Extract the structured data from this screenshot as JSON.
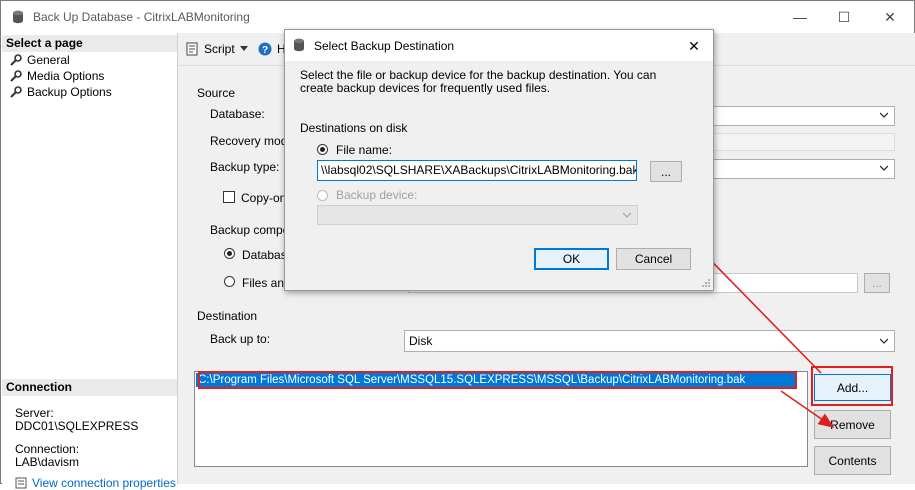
{
  "window": {
    "title": "Back Up Database - CitrixLABMonitoring",
    "minimize": "—",
    "maximize": "☐",
    "close": "✕"
  },
  "left_pane": {
    "select_header": "Select a page",
    "pages": [
      "General",
      "Media Options",
      "Backup Options"
    ],
    "connection_header": "Connection",
    "server_label": "Server:",
    "server_value": "DDC01\\SQLEXPRESS",
    "connection_label": "Connection:",
    "connection_value": "LAB\\davism",
    "view_link": "View connection properties"
  },
  "toolbar": {
    "script_label": "Script",
    "help_label": "H"
  },
  "source": {
    "header": "Source",
    "database_label": "Database:",
    "recovery_label": "Recovery mode",
    "backup_type_label": "Backup type:",
    "copy_only_label": "Copy-only",
    "component_label": "Backup compor",
    "database_radio": "Database",
    "files_radio": "Files and",
    "browse": "..."
  },
  "destination": {
    "header": "Destination",
    "back_up_to_label": "Back up to:",
    "back_up_to_value": "Disk",
    "list_item": "C:\\Program Files\\Microsoft SQL Server\\MSSQL15.SQLEXPRESS\\MSSQL\\Backup\\CitrixLABMonitoring.bak",
    "add_button": "Add...",
    "remove_button": "Remove",
    "contents_button": "Contents"
  },
  "dialog": {
    "title": "Select Backup Destination",
    "close": "✕",
    "description": "Select the file or backup device for the backup destination. You can create backup devices for frequently used files.",
    "group_label": "Destinations on disk",
    "file_name_label": "File name:",
    "file_name_value": "\\\\labsql02\\SQLSHARE\\XABackups\\CitrixLABMonitoring.bak",
    "browse_button": "...",
    "backup_device_label": "Backup device:",
    "ok_button": "OK",
    "cancel_button": "Cancel"
  },
  "colors": {
    "selection": "#0078d7",
    "highlight": "#e02020",
    "link": "#0066cc"
  }
}
